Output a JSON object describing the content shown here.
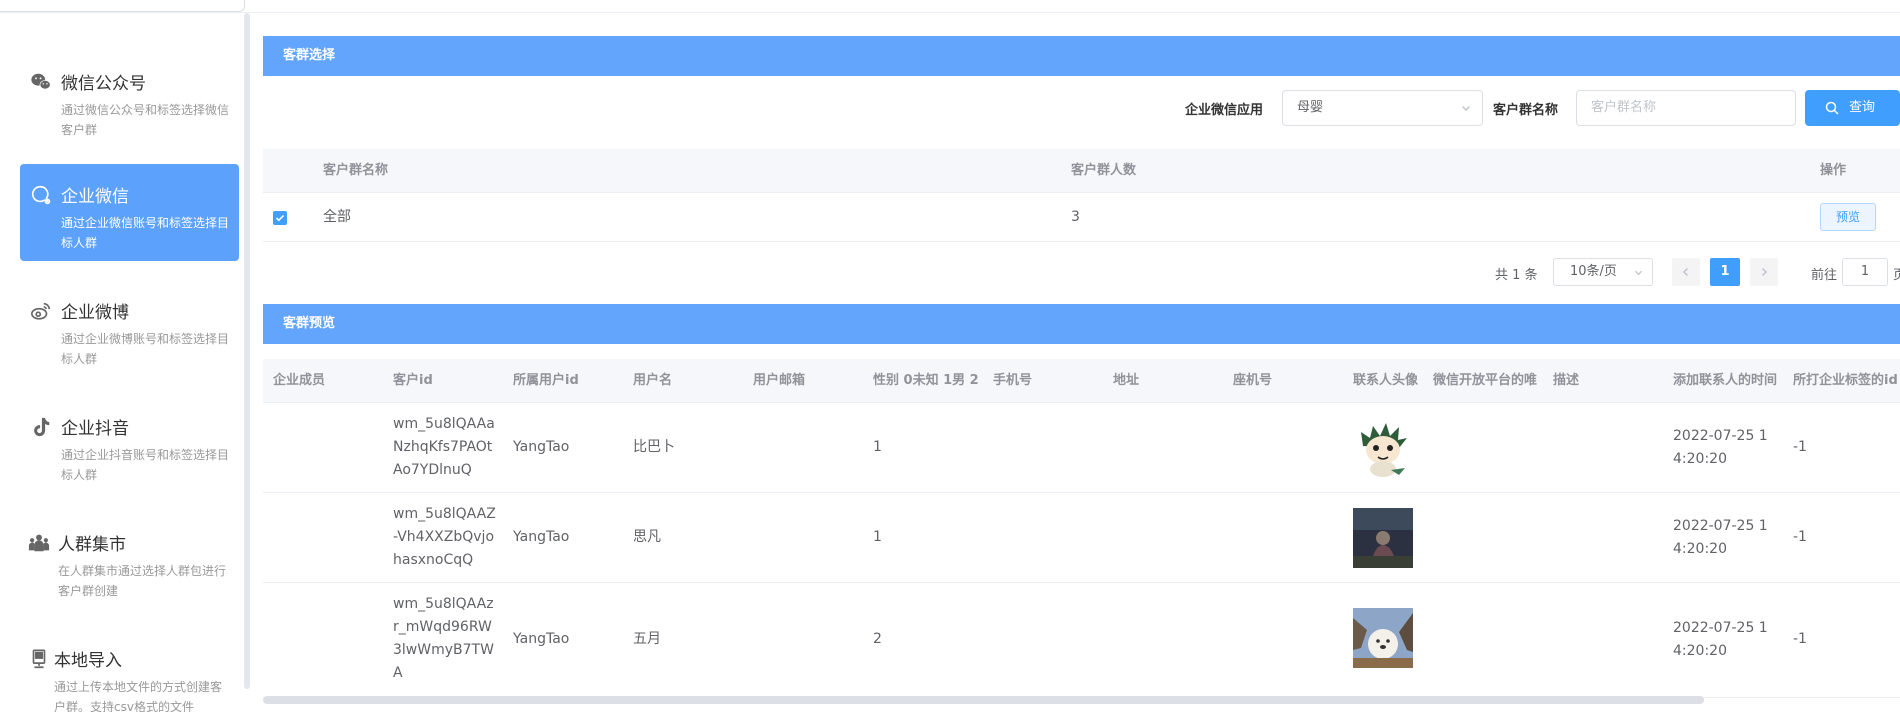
{
  "sidebar": {
    "items": [
      {
        "title": "微信公众号",
        "desc": "通过微信公众号和标签选择微信客户群",
        "icon": "wechat-icon"
      },
      {
        "title": "企业微信",
        "desc": "通过企业微信账号和标签选择目标人群",
        "icon": "wecom-icon"
      },
      {
        "title": "企业微博",
        "desc": "通过企业微博账号和标签选择目标人群",
        "icon": "weibo-icon"
      },
      {
        "title": "企业抖音",
        "desc": "通过企业抖音账号和标签选择目标人群",
        "icon": "tiktok-icon"
      },
      {
        "title": "人群集市",
        "desc": "在人群集市通过选择人群包进行客户群创建",
        "icon": "people-icon"
      },
      {
        "title": "本地导入",
        "desc": "通过上传本地文件的方式创建客户群。支持csv格式的文件",
        "icon": "upload-device-icon"
      }
    ]
  },
  "group_select": {
    "title": "客群选择",
    "filter": {
      "app_label": "企业微信应用",
      "app_value": "母婴",
      "name_label": "客户群名称",
      "name_placeholder": "客户群名称",
      "query_label": "查询"
    },
    "columns": [
      "客户群名称",
      "客户群人数",
      "操作"
    ],
    "rows": [
      {
        "name": "全部",
        "count": "3",
        "action": "预览",
        "checked": true
      }
    ],
    "pagination": {
      "total_text": "共 1 条",
      "page_size": "10条/页",
      "current_page": "1",
      "goto_label": "前往",
      "goto_value": "1",
      "page_suffix": "页"
    }
  },
  "group_preview": {
    "title": "客群预览",
    "columns": [
      "企业成员",
      "客户id",
      "所属用户id",
      "用户名",
      "用户邮箱",
      "性别 0未知 1男 2",
      "手机号",
      "地址",
      "座机号",
      "联系人头像",
      "微信开放平台的唯",
      "描述",
      "添加联系人的时间",
      "所打企业标签的id"
    ],
    "rows": [
      {
        "member": "",
        "customer_id": "wm_5u8lQAAaNzhqKfs7PAOtAo7YDlnuQ",
        "user_id": "YangTao",
        "username": "比巴卜",
        "email": "",
        "gender": "1",
        "phone": "",
        "address": "",
        "landline": "",
        "avatar": "cartoon-avatar",
        "unionid": "",
        "desc": "",
        "added_time": "2022-07-25 14:20:20",
        "tag_id": "-1"
      },
      {
        "member": "",
        "customer_id": "wm_5u8lQAAZ-Vh4XXZbQvjohasxnoCqQ",
        "user_id": "YangTao",
        "username": "思凡",
        "email": "",
        "gender": "1",
        "phone": "",
        "address": "",
        "landline": "",
        "avatar": "photo-avatar-dark",
        "unionid": "",
        "desc": "",
        "added_time": "2022-07-25 14:20:20",
        "tag_id": "-1"
      },
      {
        "member": "",
        "customer_id": "wm_5u8lQAAzr_mWqd96RW3lwWmyB7TWA",
        "user_id": "YangTao",
        "username": "五月",
        "email": "",
        "gender": "2",
        "phone": "",
        "address": "",
        "landline": "",
        "avatar": "photo-avatar-dog",
        "unionid": "",
        "desc": "",
        "added_time": "2022-07-25 14:20:20",
        "tag_id": "-1"
      }
    ]
  },
  "colors": {
    "primary": "#409eff",
    "section_bar": "#63a5fd",
    "active_sidebar": "#5ca2fc"
  }
}
